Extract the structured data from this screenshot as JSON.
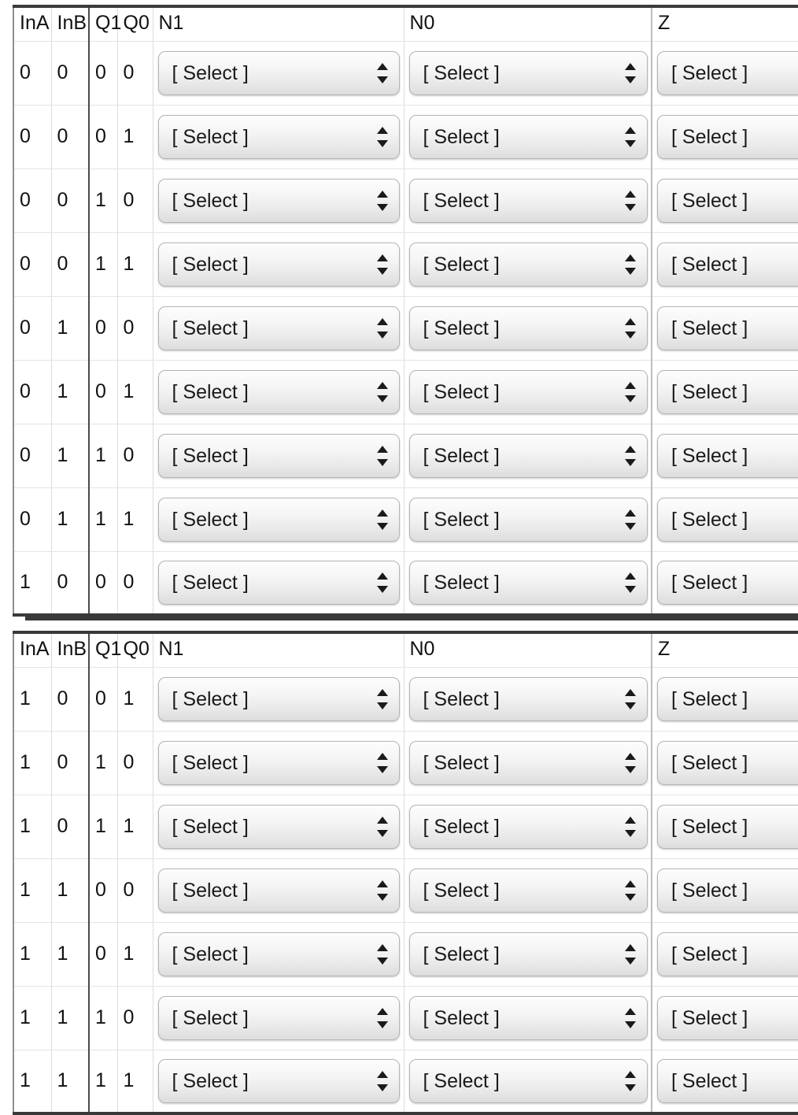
{
  "table": {
    "columns": [
      {
        "key": "ina",
        "label": "InA"
      },
      {
        "key": "inb",
        "label": "InB"
      },
      {
        "key": "q1",
        "label": "Q1"
      },
      {
        "key": "q0",
        "label": "Q0"
      },
      {
        "key": "n1",
        "label": "N1"
      },
      {
        "key": "n0",
        "label": "N0"
      },
      {
        "key": "z",
        "label": "Z"
      }
    ],
    "select_placeholder": "[ Select ]",
    "select_icon": "updown-arrows-icon",
    "sections": [
      {
        "name": "section-1",
        "headers": [
          "InA",
          "InB",
          "Q1",
          "Q0",
          "N1",
          "N0",
          "Z"
        ],
        "rows": [
          {
            "ina": "0",
            "inb": "0",
            "q1": "0",
            "q0": "0",
            "n1": "[ Select ]",
            "n0": "[ Select ]",
            "z": "[ Select ]"
          },
          {
            "ina": "0",
            "inb": "0",
            "q1": "0",
            "q0": "1",
            "n1": "[ Select ]",
            "n0": "[ Select ]",
            "z": "[ Select ]"
          },
          {
            "ina": "0",
            "inb": "0",
            "q1": "1",
            "q0": "0",
            "n1": "[ Select ]",
            "n0": "[ Select ]",
            "z": "[ Select ]"
          },
          {
            "ina": "0",
            "inb": "0",
            "q1": "1",
            "q0": "1",
            "n1": "[ Select ]",
            "n0": "[ Select ]",
            "z": "[ Select ]"
          },
          {
            "ina": "0",
            "inb": "1",
            "q1": "0",
            "q0": "0",
            "n1": "[ Select ]",
            "n0": "[ Select ]",
            "z": "[ Select ]"
          },
          {
            "ina": "0",
            "inb": "1",
            "q1": "0",
            "q0": "1",
            "n1": "[ Select ]",
            "n0": "[ Select ]",
            "z": "[ Select ]"
          },
          {
            "ina": "0",
            "inb": "1",
            "q1": "1",
            "q0": "0",
            "n1": "[ Select ]",
            "n0": "[ Select ]",
            "z": "[ Select ]"
          },
          {
            "ina": "0",
            "inb": "1",
            "q1": "1",
            "q0": "1",
            "n1": "[ Select ]",
            "n0": "[ Select ]",
            "z": "[ Select ]"
          },
          {
            "ina": "1",
            "inb": "0",
            "q1": "0",
            "q0": "0",
            "n1": "[ Select ]",
            "n0": "[ Select ]",
            "z": "[ Select ]"
          }
        ]
      },
      {
        "name": "section-2",
        "headers": [
          "InA",
          "InB",
          "Q1",
          "Q0",
          "N1",
          "N0",
          "Z"
        ],
        "rows": [
          {
            "ina": "1",
            "inb": "0",
            "q1": "0",
            "q0": "1",
            "n1": "[ Select ]",
            "n0": "[ Select ]",
            "z": "[ Select ]"
          },
          {
            "ina": "1",
            "inb": "0",
            "q1": "1",
            "q0": "0",
            "n1": "[ Select ]",
            "n0": "[ Select ]",
            "z": "[ Select ]"
          },
          {
            "ina": "1",
            "inb": "0",
            "q1": "1",
            "q0": "1",
            "n1": "[ Select ]",
            "n0": "[ Select ]",
            "z": "[ Select ]"
          },
          {
            "ina": "1",
            "inb": "1",
            "q1": "0",
            "q0": "0",
            "n1": "[ Select ]",
            "n0": "[ Select ]",
            "z": "[ Select ]"
          },
          {
            "ina": "1",
            "inb": "1",
            "q1": "0",
            "q0": "1",
            "n1": "[ Select ]",
            "n0": "[ Select ]",
            "z": "[ Select ]"
          },
          {
            "ina": "1",
            "inb": "1",
            "q1": "1",
            "q0": "0",
            "n1": "[ Select ]",
            "n0": "[ Select ]",
            "z": "[ Select ]"
          },
          {
            "ina": "1",
            "inb": "1",
            "q1": "1",
            "q0": "1",
            "n1": "[ Select ]",
            "n0": "[ Select ]",
            "z": "[ Select ]"
          }
        ]
      }
    ]
  },
  "colors": {
    "rule": "#3a3a3a",
    "cell_border": "#dcdcdc",
    "group_divider": "#4a4a4a",
    "text": "#111111",
    "select_border": "#b4b4b4"
  }
}
